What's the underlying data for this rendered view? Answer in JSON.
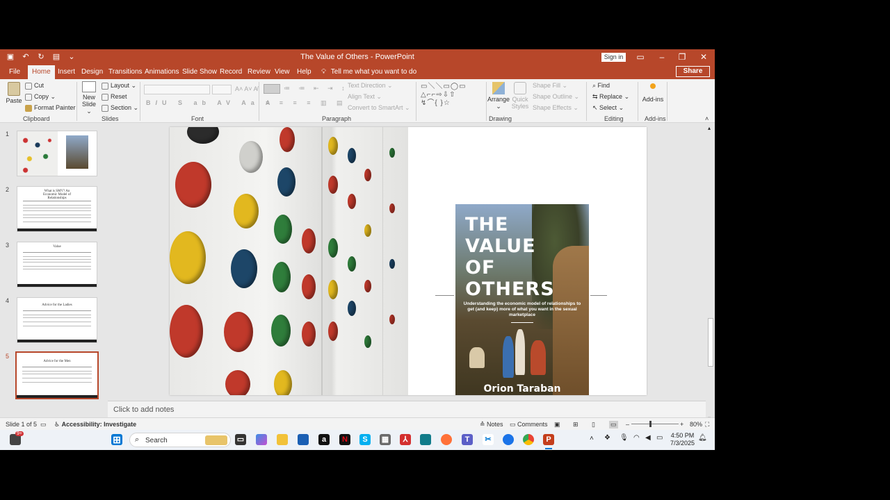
{
  "window": {
    "title": "The Value of Others  -  PowerPoint",
    "sign_in": "Sign in",
    "share": "Share"
  },
  "tabs": [
    "File",
    "Home",
    "Insert",
    "Design",
    "Transitions",
    "Animations",
    "Slide Show",
    "Record",
    "Review",
    "View",
    "Help"
  ],
  "tell_me": "Tell me what you want to do",
  "ribbon": {
    "clipboard": {
      "paste": "Paste",
      "cut": "Cut",
      "copy": "Copy",
      "format_painter": "Format Painter",
      "label": "Clipboard"
    },
    "slides": {
      "new_slide": "New",
      "new_slide2": "Slide",
      "layout": "Layout",
      "reset": "Reset",
      "section": "Section",
      "label": "Slides"
    },
    "font": {
      "label": "Font"
    },
    "paragraph": {
      "text_direction": "Text Direction",
      "align_text": "Align Text",
      "convert_smartart": "Convert to SmartArt",
      "label": "Paragraph"
    },
    "drawing": {
      "arrange": "Arrange",
      "quick_styles": "Quick",
      "quick_styles2": "Styles",
      "shape_fill": "Shape Fill",
      "shape_outline": "Shape Outline",
      "shape_effects": "Shape Effects",
      "label": "Drawing"
    },
    "editing": {
      "find": "Find",
      "replace": "Replace",
      "select": "Select",
      "label": "Editing"
    },
    "addins": {
      "addins": "Add-ins",
      "label": "Add-ins"
    }
  },
  "thumbnails": [
    {
      "num": "1"
    },
    {
      "num": "2",
      "title": "What is SMV? An Economic Model of Relationships"
    },
    {
      "num": "3",
      "title": "Value"
    },
    {
      "num": "4",
      "title": "Advice for the Ladies"
    },
    {
      "num": "5",
      "title": "Advice for the Men"
    }
  ],
  "cover": {
    "title_lines": [
      "THE",
      "VALUE",
      "OF",
      "OTHERS"
    ],
    "subtitle": "Understanding the economic model of relationships to get (and keep) more of what you want in the sexual marketplace",
    "author": "Orion Taraban"
  },
  "notes_placeholder": "Click to add notes",
  "status": {
    "slide_info": "Slide 1 of 5",
    "accessibility": "Accessibility: Investigate",
    "notes": "Notes",
    "comments": "Comments",
    "zoom": "80%"
  },
  "taskbar": {
    "search": "Search",
    "time": "4:50 PM",
    "date": "7/3/2025",
    "badge": "9+"
  },
  "colors": {
    "accent": "#b7472a"
  }
}
